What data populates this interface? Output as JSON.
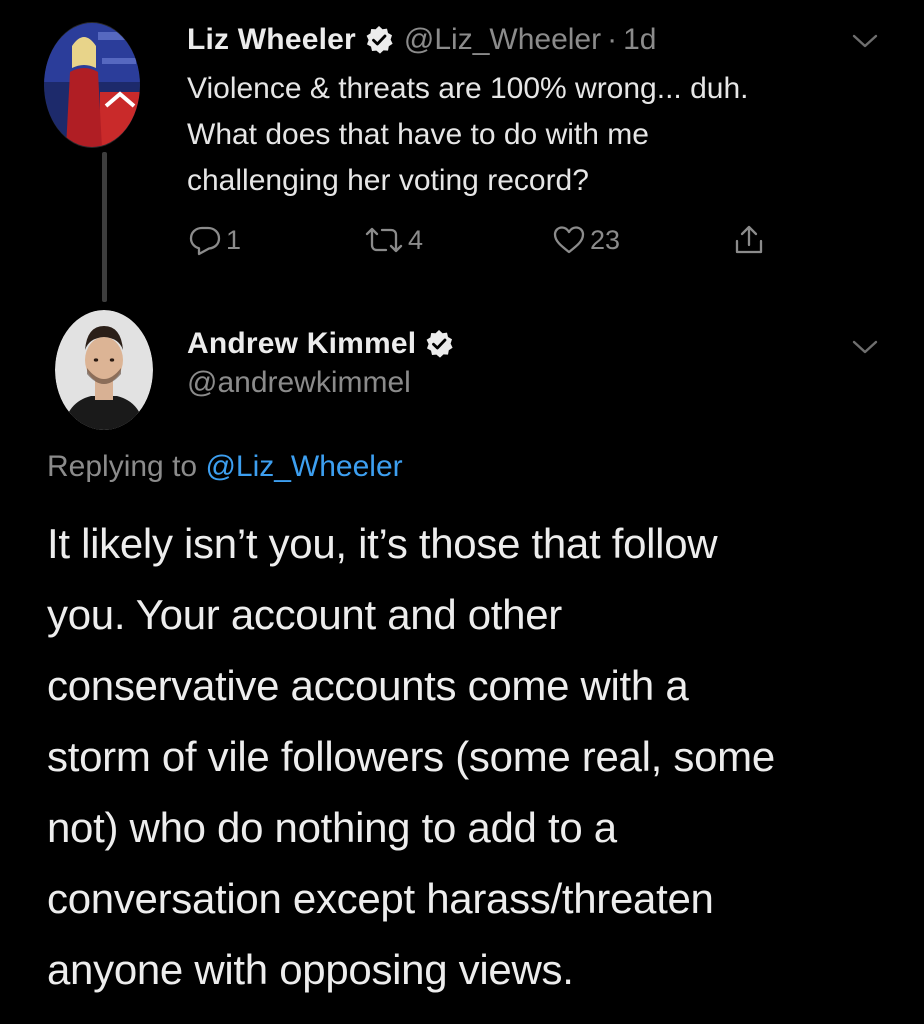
{
  "tweet1": {
    "name": "Liz Wheeler",
    "handle": "@Liz_Wheeler",
    "separator": "·",
    "time": "1d",
    "text_lines": [
      "Violence & threats are 100% wrong... duh.",
      "What does that have to do with me",
      "challenging her voting record?"
    ],
    "replies": "1",
    "retweets": "4",
    "likes": "23"
  },
  "tweet2": {
    "name": "Andrew Kimmel",
    "handle": "@andrewkimmel",
    "replying_prefix": "Replying to ",
    "replying_mention": "@Liz_Wheeler",
    "text_lines": [
      "It likely isn’t you, it’s those that follow",
      "you. Your account and other",
      "conservative accounts come with a",
      "storm of vile followers (some real, some",
      "not) who do nothing to add to a",
      "conversation except harass/threaten",
      "anyone with opposing views."
    ]
  },
  "icons": {
    "verified": "verified-badge-icon",
    "more": "chevron-down-icon",
    "reply": "reply-icon",
    "retweet": "retweet-icon",
    "like": "heart-icon",
    "share": "share-icon"
  },
  "colors": {
    "background": "#000000",
    "text": "#e6e6e6",
    "muted": "#8b8b8b",
    "link": "#3d9ff0"
  }
}
